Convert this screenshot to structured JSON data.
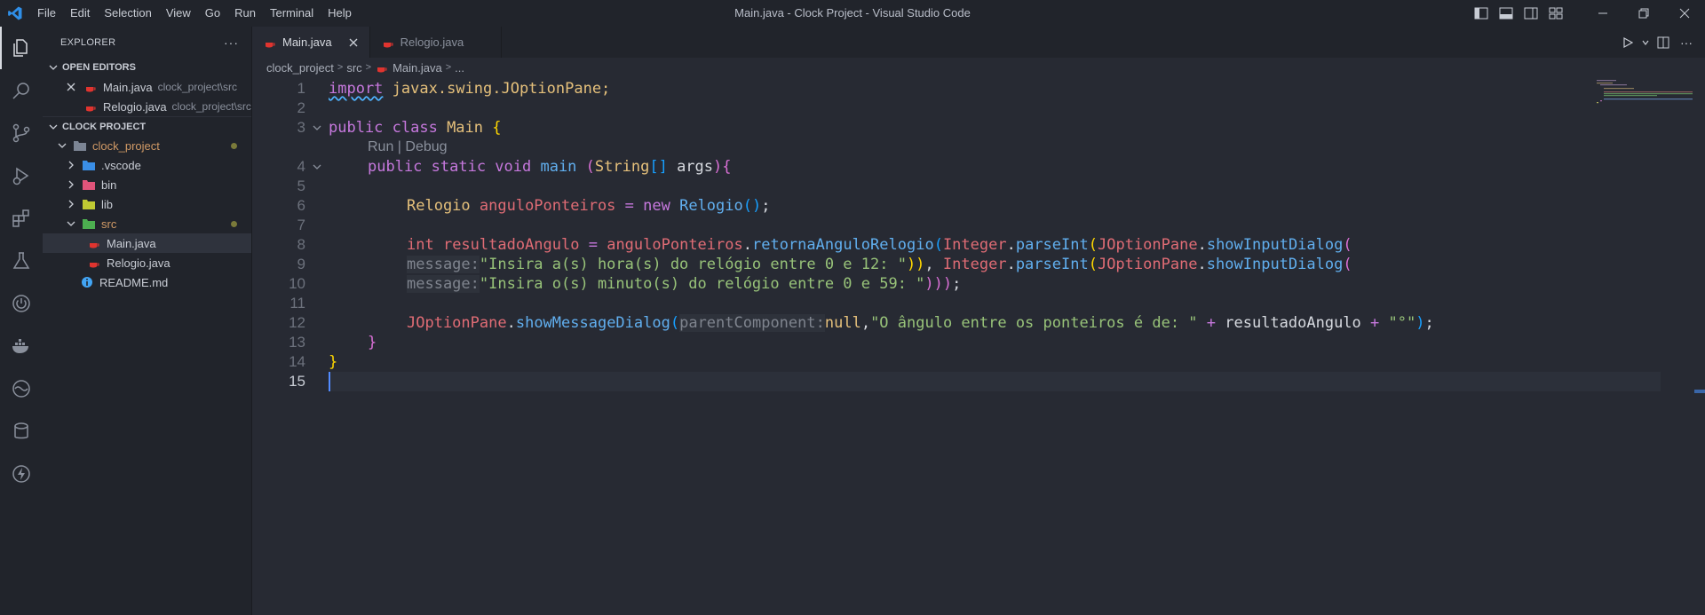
{
  "window": {
    "title": "Main.java - Clock Project - Visual Studio Code"
  },
  "menu": [
    "File",
    "Edit",
    "Selection",
    "View",
    "Go",
    "Run",
    "Terminal",
    "Help"
  ],
  "sidebar": {
    "title": "EXPLORER",
    "open_editors_label": "OPEN EDITORS",
    "open_editors": [
      {
        "name": "Main.java",
        "path": "clock_project\\src"
      },
      {
        "name": "Relogio.java",
        "path": "clock_project\\src"
      }
    ],
    "project_label": "CLOCK PROJECT",
    "tree": {
      "root": "clock_project",
      "vscode": ".vscode",
      "bin": "bin",
      "lib": "lib",
      "src": "src",
      "main": "Main.java",
      "relogio": "Relogio.java",
      "readme": "README.md"
    }
  },
  "tabs": [
    {
      "label": "Main.java",
      "active": true
    },
    {
      "label": "Relogio.java",
      "active": false
    }
  ],
  "breadcrumb": [
    "clock_project",
    "src",
    "Main.java",
    "..."
  ],
  "editor": {
    "line_numbers": [
      "1",
      "2",
      "3",
      "4",
      "5",
      "6",
      "7",
      "8",
      "9",
      "10",
      "11",
      "12",
      "13",
      "14",
      "15"
    ],
    "codelens": "Run | Debug",
    "l1": {
      "kw": "import",
      "rest": " javax.swing.JOptionPane;"
    },
    "l3": {
      "kw": "public class ",
      "cls": "Main",
      "brace": " {"
    },
    "l4": {
      "kw": "public static void ",
      "fn": "main",
      "sp": " ",
      "p1": "(",
      "ty": "String",
      "arr": "[]",
      "arg": " args",
      "p2": ")",
      "brace": "{"
    },
    "l6": {
      "ty": "Relogio",
      "var": " anguloPonteiros",
      "eq": " = ",
      "kw": "new ",
      "cls": "Relogio",
      "par": "()",
      "semi": ";"
    },
    "l8": {
      "kw": "int",
      "var": " resultadoAngulo",
      "eq": " = ",
      "obj": "anguloPonteiros",
      "dot": ".",
      "fn": "retornaAnguloRelogio",
      "p1": "(",
      "cls": "Integer",
      "dot2": ".",
      "fn2": "parseInt",
      "p2": "(",
      "cls2": "JOptionPane",
      "dot3": ".",
      "fn3": "showInputDialog",
      "p3": "("
    },
    "l9": {
      "hint": "message:",
      "str": "\"Insira a(s) hora(s) do relógio entre 0 e 12: \"",
      "close": "))",
      "comma": ", ",
      "cls": "Integer",
      "dot": ".",
      "fn": "parseInt",
      "p1": "(",
      "cls2": "JOptionPane",
      "dot2": ".",
      "fn2": "showInputDialog",
      "p2": "("
    },
    "l10": {
      "hint": "message:",
      "str": "\"Insira o(s) minuto(s) do relógio entre 0 e 59: \"",
      "close": ")))",
      "semi": ";"
    },
    "l12": {
      "cls": "JOptionPane",
      "dot": ".",
      "fn": "showMessageDialog",
      "p1": "(",
      "hint": "parentComponent:",
      "null": "null",
      "comma": ",",
      "str": "\"O ângulo entre os ponteiros é de: \"",
      "plus": " + ",
      "var": "resultadoAngulo",
      "plus2": " + ",
      "str2": "\"°\"",
      "p2": ")",
      "semi": ";"
    },
    "l13": "}",
    "l14": "}"
  },
  "colors": {
    "accent": "#61afef",
    "keyword": "#c678dd",
    "string": "#98c379",
    "type": "#e5c07b"
  }
}
